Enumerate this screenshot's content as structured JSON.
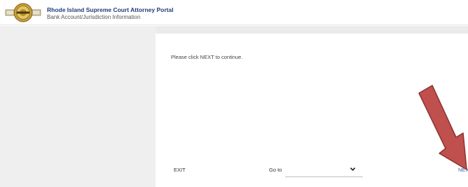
{
  "header": {
    "title": "Rhode Island Supreme Court Attorney Portal",
    "subtitle": "Bank Account/Jurisdiction Information",
    "logo_icon": "court-seal-logo"
  },
  "main": {
    "prompt": "Please click NEXT to continue."
  },
  "footer": {
    "exit_label": "EXIT",
    "goto_label": "Go to",
    "goto_value": "",
    "next_label": "NEXT"
  },
  "annotation": {
    "arrow_icon": "red-arrow-pointing-to-next",
    "arrow_color": "#c0504d"
  },
  "colors": {
    "title": "#1f3d7a",
    "link": "#2a6ab0",
    "sidebar_bg": "#efefef"
  }
}
